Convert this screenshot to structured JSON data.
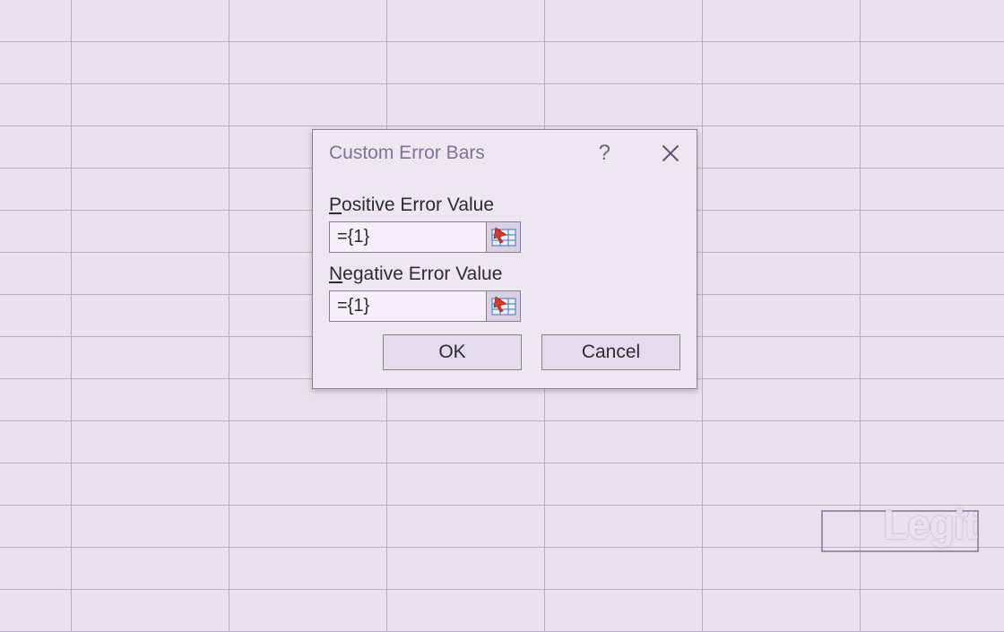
{
  "dialog": {
    "title": "Custom Error Bars",
    "help_char": "?",
    "fields": {
      "positive": {
        "label_prefix": "P",
        "label_rest": "ositive Error Value",
        "value": "={1}"
      },
      "negative": {
        "label_prefix": "N",
        "label_rest": "egative Error Value",
        "value": "={1}"
      }
    },
    "ok_label": "OK",
    "cancel_label": "Cancel"
  },
  "watermark": "Legit"
}
